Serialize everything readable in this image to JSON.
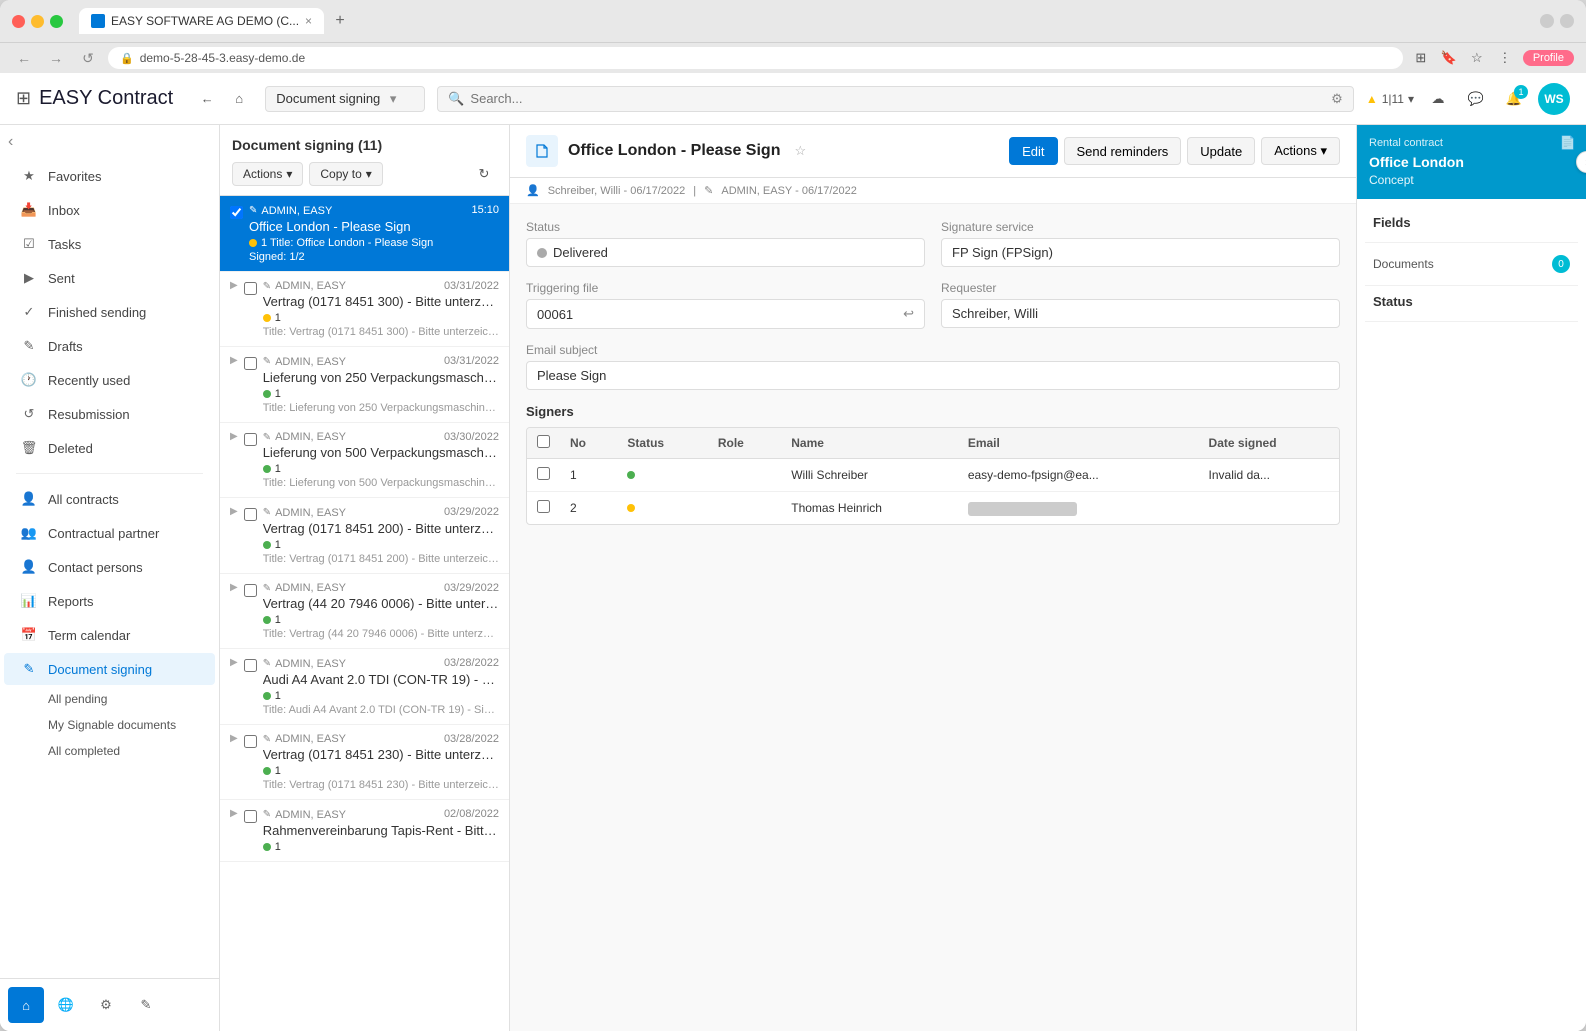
{
  "browser": {
    "url": "demo-5-28-45-3.easy-demo.de",
    "tab_title": "EASY SOFTWARE AG DEMO (C...",
    "close_label": "×",
    "new_tab": "+"
  },
  "header": {
    "app_title": "EASY Contract",
    "nav_back": "←",
    "nav_home": "⌂",
    "dropdown_label": "Document signing",
    "search_placeholder": "Search...",
    "filter_icon": "⚙",
    "notification_count": "1",
    "traffic_label": "1|11",
    "user_initials": "WS",
    "cloud_icon": "☁",
    "chat_icon": "💬"
  },
  "sidebar": {
    "collapse_icon": "‹",
    "items": [
      {
        "id": "favorites",
        "label": "Favorites",
        "icon": "★"
      },
      {
        "id": "inbox",
        "label": "Inbox",
        "icon": "📥"
      },
      {
        "id": "tasks",
        "label": "Tasks",
        "icon": "✓"
      },
      {
        "id": "sent",
        "label": "Sent",
        "icon": "▶"
      },
      {
        "id": "finished-sending",
        "label": "Finished sending",
        "icon": "✓✓"
      },
      {
        "id": "drafts",
        "label": "Drafts",
        "icon": "✎"
      },
      {
        "id": "recently-used",
        "label": "Recently used",
        "icon": "🕐"
      },
      {
        "id": "resubmission",
        "label": "Resubmission",
        "icon": "↺"
      },
      {
        "id": "deleted",
        "label": "Deleted",
        "icon": "🗑"
      },
      {
        "id": "all-contracts",
        "label": "All contracts",
        "icon": "👤"
      },
      {
        "id": "contractual-partner",
        "label": "Contractual partner",
        "icon": "👥"
      },
      {
        "id": "contact-persons",
        "label": "Contact persons",
        "icon": "👤"
      },
      {
        "id": "reports",
        "label": "Reports",
        "icon": "📊"
      },
      {
        "id": "term-calendar",
        "label": "Term calendar",
        "icon": "📅"
      },
      {
        "id": "document-signing",
        "label": "Document signing",
        "icon": "✎",
        "active": true
      }
    ],
    "children": [
      {
        "id": "all-pending",
        "label": "All pending"
      },
      {
        "id": "my-signable",
        "label": "My Signable documents"
      },
      {
        "id": "all-completed",
        "label": "All completed"
      }
    ],
    "bottom_items": [
      {
        "id": "home",
        "label": "Home",
        "icon": "⌂",
        "active": true
      },
      {
        "id": "globe",
        "label": "Globe",
        "icon": "🌐"
      },
      {
        "id": "settings",
        "label": "Settings",
        "icon": "⚙"
      },
      {
        "id": "sign",
        "label": "Sign",
        "icon": "✎"
      }
    ]
  },
  "list_panel": {
    "title": "Document signing (11)",
    "actions_label": "Actions",
    "copy_to_label": "Copy to",
    "dropdown_arrow": "▾",
    "refresh_icon": "↻",
    "items": [
      {
        "id": "item-1",
        "author": "ADMIN, EASY",
        "time": "15:10",
        "title": "Office London - Please Sign",
        "dot_color": "yellow",
        "meta": "1 Title: Office London - Please Sign",
        "subtitle": "Signed: 1/2",
        "selected": true,
        "expand": false
      },
      {
        "id": "item-2",
        "author": "ADMIN, EASY",
        "time": "03/31/2022",
        "title": "Vertrag (0171 8451 300) - Bitte unterzeic...",
        "dot_color": "yellow",
        "meta": "1",
        "subtitle": "Title: Vertrag (0171 8451 300) - Bitte unterzeichne...",
        "selected": false,
        "expand": true
      },
      {
        "id": "item-3",
        "author": "ADMIN, EASY",
        "time": "03/31/2022",
        "title": "Lieferung von 250 Verpackungsmaschinen...",
        "dot_color": "green",
        "meta": "1",
        "subtitle": "Title: Lieferung von 250 Verpackungsmaschinen - ...",
        "selected": false,
        "expand": true
      },
      {
        "id": "item-4",
        "author": "ADMIN, EASY",
        "time": "03/30/2022",
        "title": "Lieferung von 500 Verpackungsmaschinen...",
        "dot_color": "green",
        "meta": "1",
        "subtitle": "Title: Lieferung von 500 Verpackungsmaschinen - ...",
        "selected": false,
        "expand": true
      },
      {
        "id": "item-5",
        "author": "ADMIN, EASY",
        "time": "03/29/2022",
        "title": "Vertrag (0171 8451 200) - Bitte unterzeic...",
        "dot_color": "green",
        "meta": "1",
        "subtitle": "Title: Vertrag (0171 8451 200) - Bitte unterzeichne...",
        "selected": false,
        "expand": true
      },
      {
        "id": "item-6",
        "author": "ADMIN, EASY",
        "time": "03/29/2022",
        "title": "Vertrag (44 20 7946 0006) - Bitte unterze...",
        "dot_color": "green",
        "meta": "1",
        "subtitle": "Title: Vertrag (44 20 7946 0006) - Bitte unterzeich...",
        "selected": false,
        "expand": true
      },
      {
        "id": "item-7",
        "author": "ADMIN, EASY",
        "time": "03/28/2022",
        "title": "Audi A4 Avant 2.0 TDI (CON-TR 19) - Sig...",
        "dot_color": "green",
        "meta": "1",
        "subtitle": "Title: Audi A4 Avant 2.0 TDI (CON-TR 19) - Signatur...",
        "selected": false,
        "expand": true
      },
      {
        "id": "item-8",
        "author": "ADMIN, EASY",
        "time": "03/28/2022",
        "title": "Vertrag (0171 8451 230) - Bitte unterzeic...",
        "dot_color": "green",
        "meta": "1",
        "subtitle": "Title: Vertrag (0171 8451 230) - Bitte unterzeichne...",
        "selected": false,
        "expand": true
      },
      {
        "id": "item-9",
        "author": "ADMIN, EASY",
        "time": "02/08/2022",
        "title": "Rahmenvereinbarung Tapis-Rent - Bitte ...",
        "dot_color": "green",
        "meta": "1",
        "subtitle": "",
        "selected": false,
        "expand": true
      }
    ]
  },
  "detail": {
    "icon": "✎",
    "title": "Office London - Please Sign",
    "star_icon": "☆",
    "nav_prev": "‹",
    "nav_next": "›",
    "edit_label": "Edit",
    "send_reminders_label": "Send reminders",
    "update_label": "Update",
    "actions_label": "Actions",
    "actions_arrow": "▾",
    "meta_author": "Schreiber, Willi - 06/17/2022",
    "meta_admin": "ADMIN, EASY - 06/17/2022",
    "meta_pencil": "✎",
    "meta_user": "👤",
    "status_label": "Status",
    "status_value": "Delivered",
    "signature_service_label": "Signature service",
    "signature_service_value": "FP Sign (FPSign)",
    "triggering_file_label": "Triggering file",
    "triggering_file_value": "00061",
    "requester_label": "Requester",
    "requester_value": "Schreiber, Willi",
    "email_subject_label": "Email subject",
    "email_subject_value": "Please Sign",
    "signers_title": "Signers",
    "signers_columns": [
      "",
      "No",
      "Status",
      "Role",
      "Name",
      "Email",
      "Date signed"
    ],
    "signers_rows": [
      {
        "no": "1",
        "status": "green",
        "role": "",
        "name": "Willi Schreiber",
        "email": "easy-demo-fpsign@ea...",
        "date_signed": "Invalid da..."
      },
      {
        "no": "2",
        "status": "yellow",
        "role": "",
        "name": "Thomas Heinrich",
        "email": "████████████",
        "date_signed": ""
      }
    ]
  },
  "right_panel": {
    "label": "Rental contract",
    "title": "Office London",
    "subtitle": "Concept",
    "nav_icon": "›",
    "doc_icon": "📄",
    "sections": [
      {
        "id": "fields",
        "label": "Fields"
      },
      {
        "id": "documents",
        "label": "Documents",
        "badge": "0"
      },
      {
        "id": "status",
        "label": "Status"
      }
    ]
  }
}
